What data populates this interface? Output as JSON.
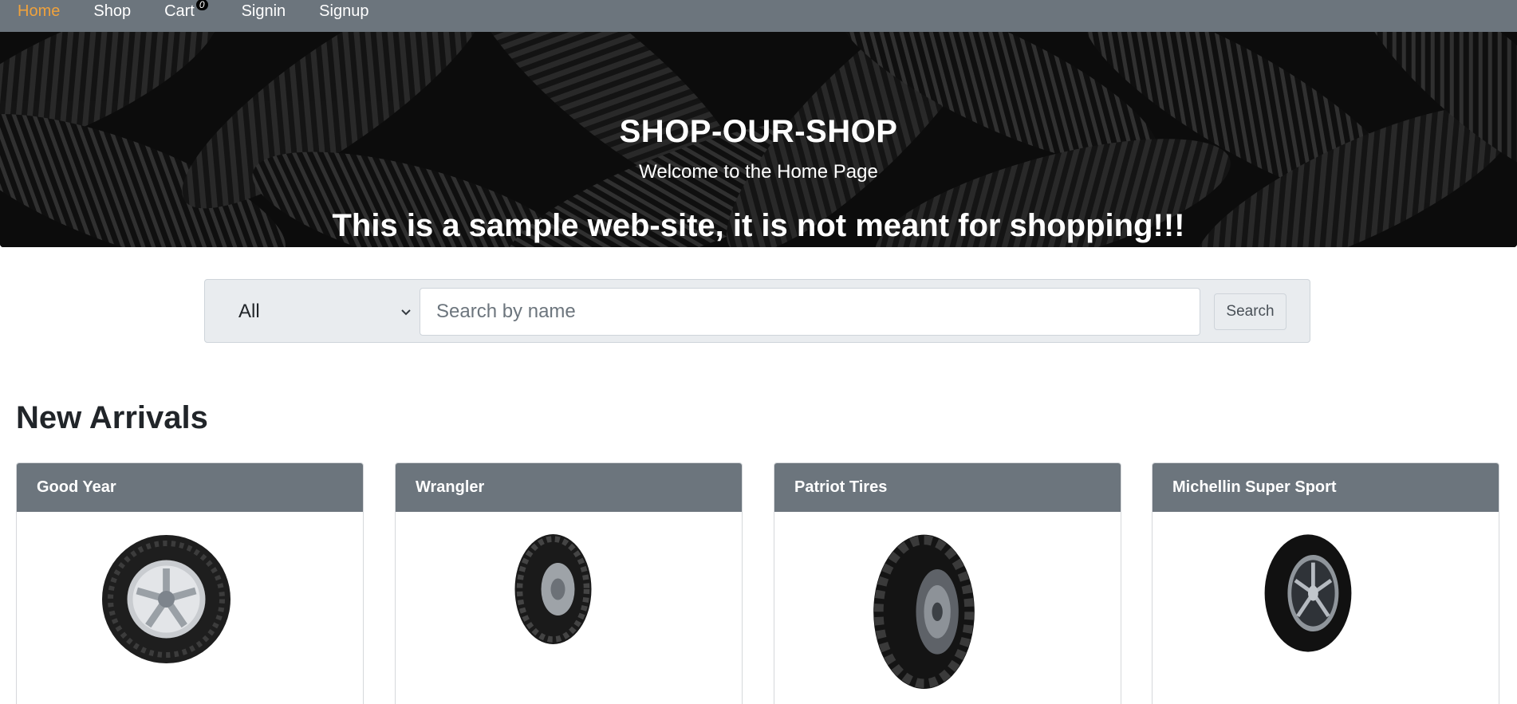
{
  "navbar": {
    "items": [
      {
        "label": "Home",
        "active": true
      },
      {
        "label": "Shop",
        "active": false
      },
      {
        "label": "Cart",
        "active": false
      },
      {
        "label": "Signin",
        "active": false
      },
      {
        "label": "Signup",
        "active": false
      }
    ],
    "cart_count": "0",
    "active_color": "#f0a23c",
    "background_color": "#6c757d"
  },
  "hero": {
    "title": "SHOP-OUR-SHOP",
    "subtitle": "Welcome to the Home Page",
    "notice": "This is a sample web-site, it is not meant for shopping!!!",
    "background": "black tires photo"
  },
  "search": {
    "category_selected": "All",
    "placeholder": "Search by name",
    "value": "",
    "button_label": "Search"
  },
  "new_arrivals": {
    "title": "New Arrivals",
    "products": [
      {
        "name": "Good Year",
        "image": "tire-icon"
      },
      {
        "name": "Wrangler",
        "image": "tire-icon"
      },
      {
        "name": "Patriot Tires",
        "image": "tire-icon"
      },
      {
        "name": "Michellin Super Sport",
        "image": "tire-icon"
      }
    ]
  }
}
